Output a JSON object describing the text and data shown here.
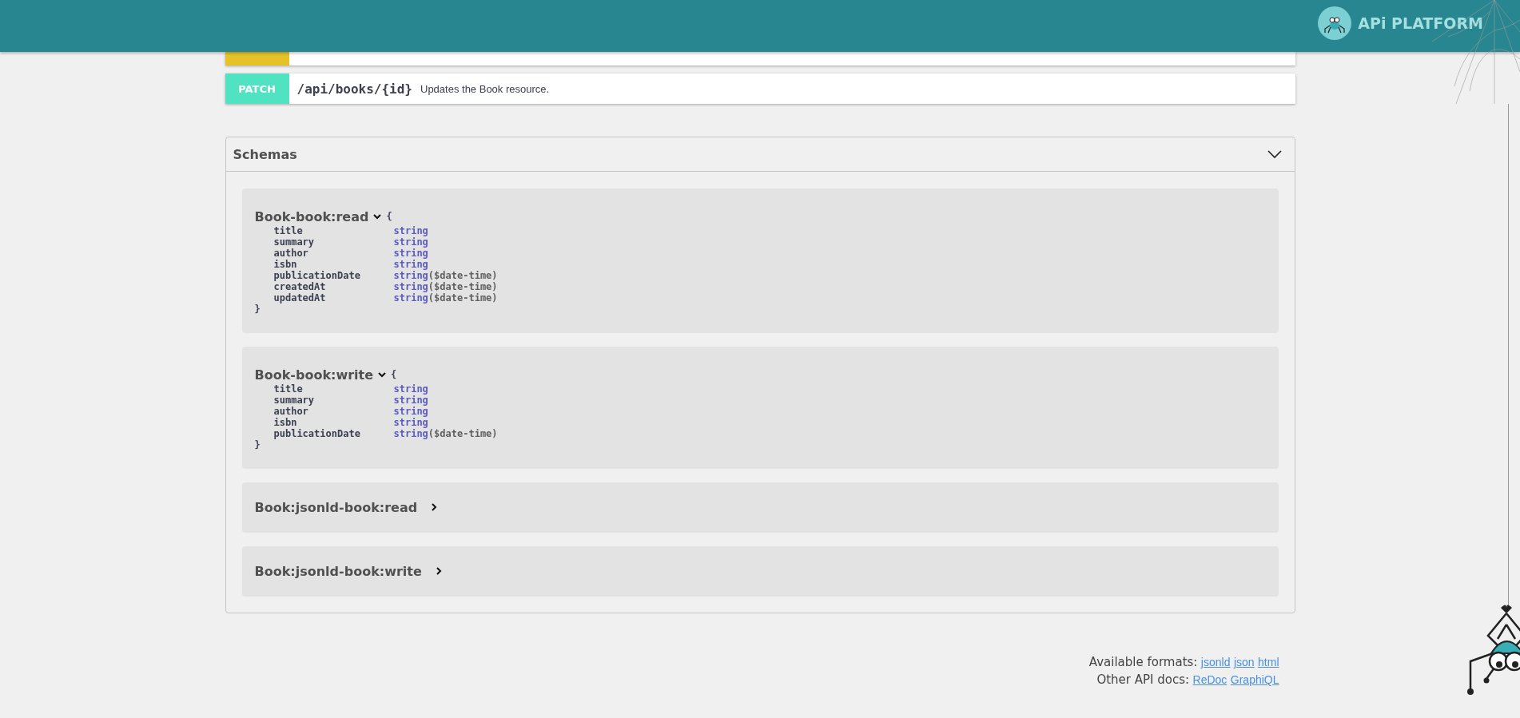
{
  "header": {
    "logo_text": "APi PLATFORM"
  },
  "operations": [
    {
      "kind": "cut",
      "color": "#e6c229"
    },
    {
      "method": "PATCH",
      "color": "#50e3c2",
      "path": "/api/books/{id}",
      "summary": "Updates the Book resource."
    }
  ],
  "schemas": {
    "title": "Schemas",
    "expanded": true,
    "models": [
      {
        "name": "Book-book:read",
        "expanded": true,
        "open_brace": "{",
        "close_brace": "}",
        "properties": [
          {
            "name": "title",
            "type": "string"
          },
          {
            "name": "summary",
            "type": "string"
          },
          {
            "name": "author",
            "type": "string"
          },
          {
            "name": "isbn",
            "type": "string"
          },
          {
            "name": "publicationDate",
            "type": "string",
            "format": "($date-time)"
          },
          {
            "name": "createdAt",
            "type": "string",
            "format": "($date-time)"
          },
          {
            "name": "updatedAt",
            "type": "string",
            "format": "($date-time)"
          }
        ]
      },
      {
        "name": "Book-book:write",
        "expanded": true,
        "open_brace": "{",
        "close_brace": "}",
        "properties": [
          {
            "name": "title",
            "type": "string"
          },
          {
            "name": "summary",
            "type": "string"
          },
          {
            "name": "author",
            "type": "string"
          },
          {
            "name": "isbn",
            "type": "string"
          },
          {
            "name": "publicationDate",
            "type": "string",
            "format": "($date-time)"
          }
        ]
      },
      {
        "name": "Book:jsonld-book:read",
        "expanded": false
      },
      {
        "name": "Book:jsonld-book:write",
        "expanded": false
      }
    ]
  },
  "footer": {
    "formats_label": "Available formats:",
    "formats": [
      "jsonld",
      "json",
      "html"
    ],
    "docs_label": "Other API docs:",
    "docs": [
      "ReDoc",
      "GraphiQL"
    ]
  }
}
